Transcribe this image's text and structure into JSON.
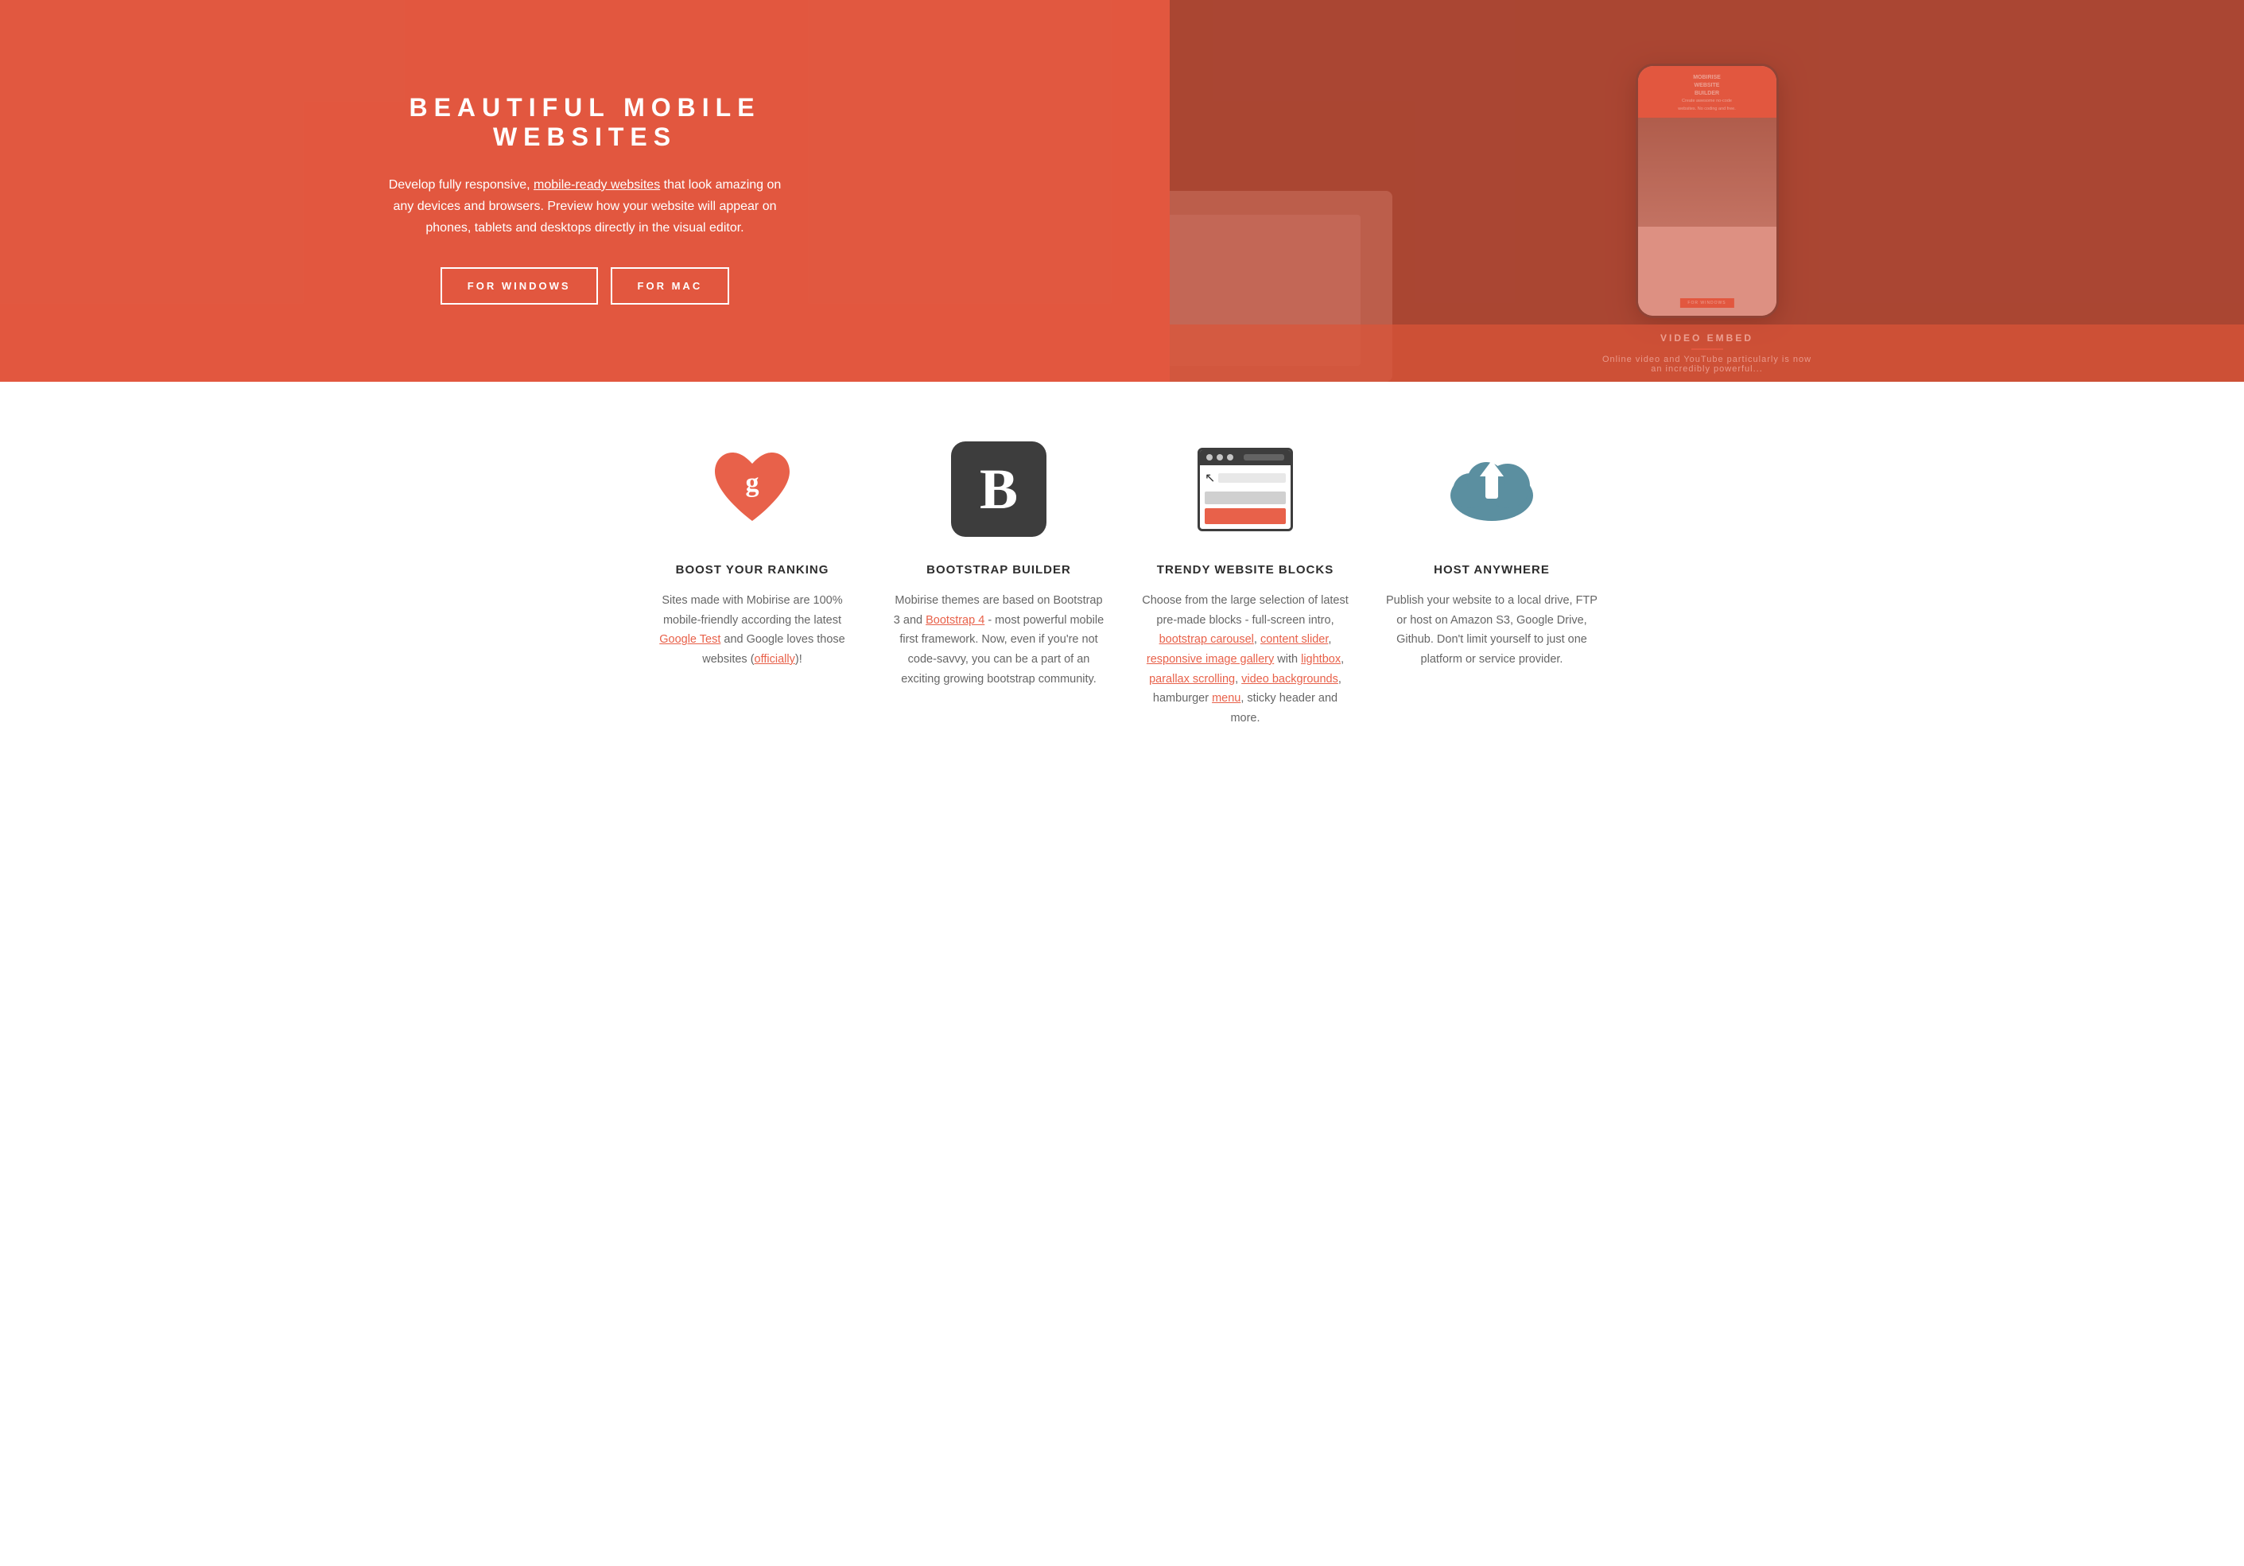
{
  "hero": {
    "title": "BEAUTIFUL MOBILE WEBSITES",
    "description_start": "Develop fully responsive, ",
    "description_link": "mobile-ready websites",
    "description_end": " that look amazing on any devices and browsers. Preview how your website will appear on phones, tablets and desktops directly in the visual editor.",
    "btn_windows": "FOR WINDOWS",
    "btn_mac": "FOR MAC",
    "phone_screen_title": "MOBIRISE\nWEBSITE\nBUILDER",
    "phone_screen_subtitle": "Create awesome no-code\nwebsites. No coding and free.",
    "video_embed_label": "VIDEO EMBED"
  },
  "features": [
    {
      "id": "boost-ranking",
      "icon_type": "heart",
      "title": "BOOST YOUR RANKING",
      "description_start": "Sites made with Mobirise are 100% mobile-friendly according the latest ",
      "link1_text": "Google Test",
      "description_middle": " and Google loves those websites (",
      "link2_text": "officially",
      "description_end": ")!"
    },
    {
      "id": "bootstrap-builder",
      "icon_type": "bootstrap",
      "title": "BOOTSTRAP BUILDER",
      "description_start": "Mobirise themes are based on Bootstrap 3 and ",
      "link1_text": "Bootstrap 4",
      "description_end": " - most powerful mobile first framework. Now, even if you're not code-savvy, you can be a part of an exciting growing bootstrap community."
    },
    {
      "id": "trendy-blocks",
      "icon_type": "browser",
      "title": "TRENDY WEBSITE BLOCKS",
      "description_start": "Choose from the large selection of latest pre-made blocks - full-screen intro, ",
      "link1_text": "bootstrap carousel",
      "d2": ", ",
      "link2_text": "content slider",
      "d3": ", ",
      "link3_text": "responsive image gallery",
      "d4": " with ",
      "link4_text": "lightbox",
      "d5": ", ",
      "link5_text": "parallax scrolling",
      "d6": ", ",
      "link6_text": "video backgrounds",
      "d7": ", hamburger ",
      "link7_text": "menu",
      "description_end": ", sticky header and more."
    },
    {
      "id": "host-anywhere",
      "icon_type": "cloud",
      "title": "HOST ANYWHERE",
      "description": "Publish your website to a local drive, FTP or host on Amazon S3, Google Drive, Github. Don't limit yourself to just one platform or service provider."
    }
  ],
  "colors": {
    "accent": "#e8614a",
    "dark": "#3d3d3d",
    "text": "#666666",
    "title": "#2d2d2d",
    "link": "#e8614a"
  }
}
